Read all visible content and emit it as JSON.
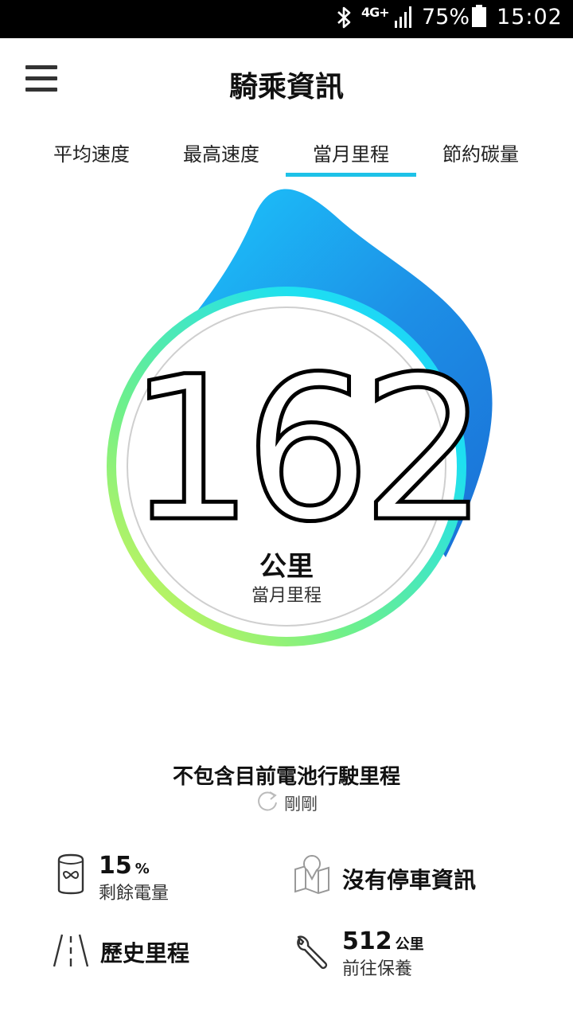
{
  "status_bar": {
    "network": "4G+",
    "battery_percent": "75%",
    "time": "15:02",
    "icons": [
      "bluetooth-icon",
      "signal-icon",
      "battery-icon"
    ]
  },
  "header": {
    "title": "騎乘資訊",
    "menu_icon": "menu-icon"
  },
  "tabs": [
    {
      "label": "平均速度",
      "active": false
    },
    {
      "label": "最高速度",
      "active": false
    },
    {
      "label": "當月里程",
      "active": true
    },
    {
      "label": "節約碳量",
      "active": false
    }
  ],
  "gauge": {
    "value": "162",
    "unit": "公里",
    "label": "當月里程",
    "colors": {
      "blob_start": "#1ccfff",
      "blob_end": "#1a6fd6",
      "ring_start": "#e9f54a",
      "ring_mid": "#6ff08a",
      "ring_end": "#1ee0f0"
    }
  },
  "note": {
    "title": "不包含目前電池行駛里程",
    "refresh_text": "剛剛",
    "refresh_icon": "refresh-icon"
  },
  "info": {
    "battery": {
      "value": "15",
      "unit": "%",
      "label": "剩餘電量",
      "icon": "battery-cell-icon"
    },
    "parking": {
      "title": "沒有停車資訊",
      "icon": "map-pin-icon"
    },
    "history": {
      "title": "歷史里程",
      "icon": "road-icon"
    },
    "maintenance": {
      "value": "512",
      "unit": "公里",
      "label": "前往保養",
      "icon": "wrench-icon"
    }
  }
}
